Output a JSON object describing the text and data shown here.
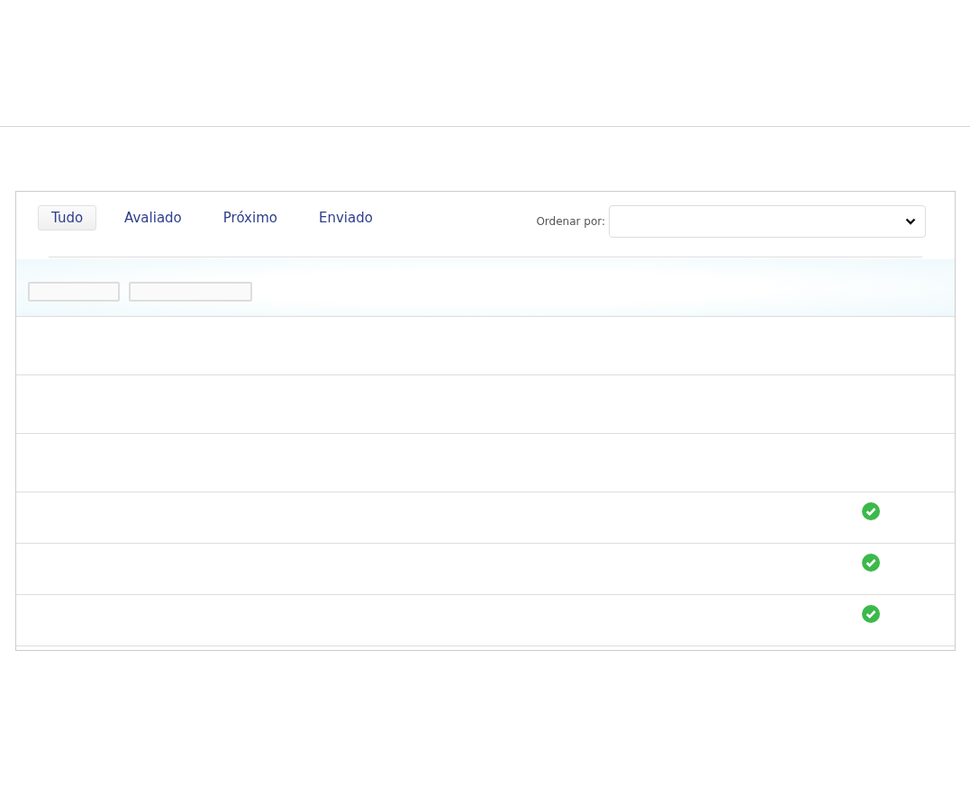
{
  "tabs": [
    {
      "label": "Tudo",
      "selected": true
    },
    {
      "label": "Avaliado",
      "selected": false
    },
    {
      "label": "Próximo",
      "selected": false
    },
    {
      "label": "Enviado",
      "selected": false
    }
  ],
  "sort": {
    "label": "Ordenar por:"
  },
  "rows": [
    {
      "completed": false
    },
    {
      "completed": false
    },
    {
      "completed": false
    },
    {
      "completed": true
    },
    {
      "completed": true
    },
    {
      "completed": true
    }
  ]
}
